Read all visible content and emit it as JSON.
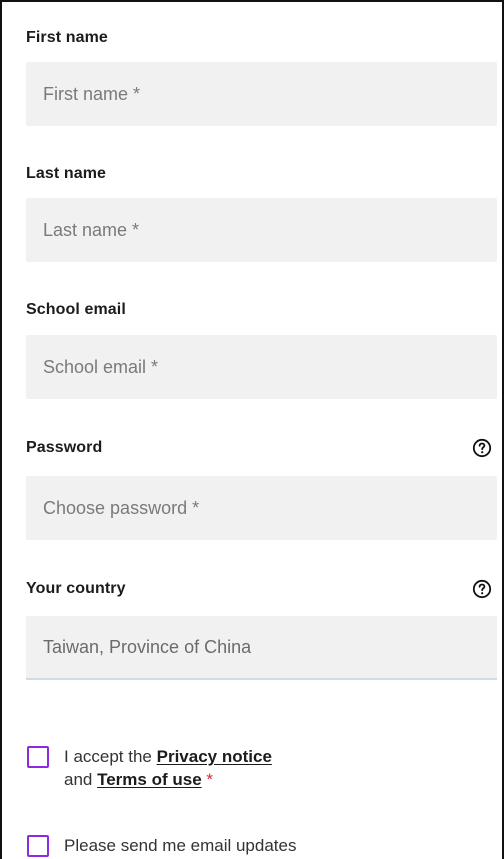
{
  "form": {
    "first_name": {
      "label": "First name",
      "placeholder": "First name *"
    },
    "last_name": {
      "label": "Last name",
      "placeholder": "Last name *"
    },
    "school_email": {
      "label": "School email",
      "placeholder": "School email *"
    },
    "password": {
      "label": "Password",
      "placeholder": "Choose password *",
      "help_icon": "question-circle-icon"
    },
    "country": {
      "label": "Your country",
      "selected": "Taiwan, Province of China",
      "help_icon": "question-circle-icon"
    },
    "accept_terms": {
      "text_prefix": "I accept the",
      "privacy_link": "Privacy notice",
      "text_mid": "and",
      "terms_link": "Terms of use",
      "required_mark": "*",
      "checked": false
    },
    "email_updates": {
      "text": "Please send me email updates",
      "checked": false
    }
  },
  "colors": {
    "field_bg": "#f1f1f1",
    "checkbox_border": "#8a2be2",
    "required": "#d7263d"
  }
}
